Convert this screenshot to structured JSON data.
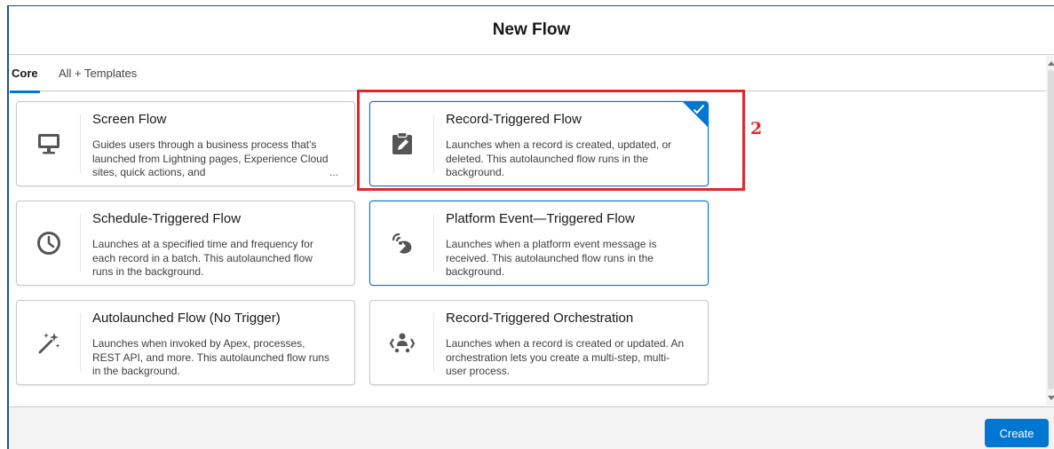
{
  "modal": {
    "title": "New Flow"
  },
  "tabs": [
    {
      "label": "Core",
      "active": true
    },
    {
      "label": "All + Templates",
      "active": false
    }
  ],
  "cards": [
    {
      "title": "Screen Flow",
      "description": "Guides users through a business process that's launched from Lightning pages, Experience Cloud sites, quick actions, and",
      "more": "...",
      "icon": "desktop-icon"
    },
    {
      "title": "Record-Triggered Flow",
      "description": "Launches when a record is created, updated, or deleted. This autolaunched flow runs in the background.",
      "icon": "record-edit-icon",
      "selected": true
    },
    {
      "title": "Schedule-Triggered Flow",
      "description": "Launches at a specified time and frequency for each record in a batch. This autolaunched flow runs in the background.",
      "icon": "clock-icon"
    },
    {
      "title": "Platform Event—Triggered Flow",
      "description": "Launches when a platform event message is received. This autolaunched flow runs in the background.",
      "icon": "broadcast-icon"
    },
    {
      "title": "Autolaunched Flow (No Trigger)",
      "description": "Launches when invoked by Apex, processes, REST API, and more. This autolaunched flow runs in the background.",
      "icon": "magic-wand-icon"
    },
    {
      "title": "Record-Triggered Orchestration",
      "description": "Launches when a record is created or updated. An orchestration lets you create a multi-step, multi-user process.",
      "icon": "orchestration-icon"
    }
  ],
  "annotation": {
    "label": "2",
    "color": "#e5252a"
  },
  "footer": {
    "create_label": "Create"
  },
  "colors": {
    "brand": "#0176d3",
    "border": "#c9c9c9",
    "icon": "#555555"
  }
}
